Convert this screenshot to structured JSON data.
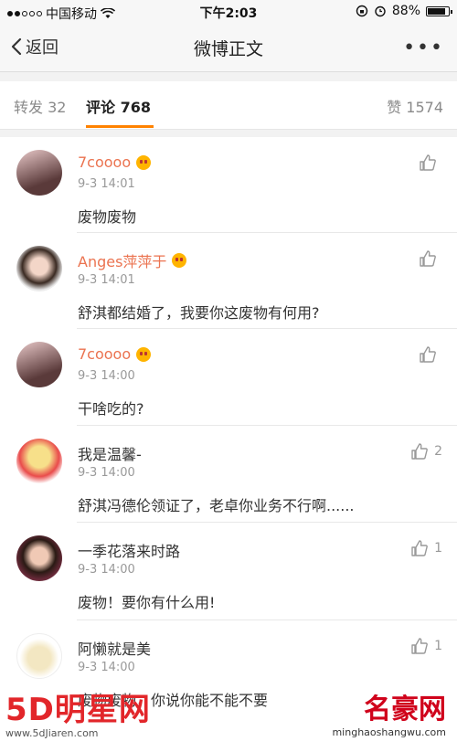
{
  "status_bar": {
    "carrier": "中国移动",
    "time": "下午2:03",
    "battery": "88%",
    "battery_level": 0.88,
    "icons": [
      "wifi-icon",
      "lock-rotation-icon",
      "alarm-icon",
      "battery-icon"
    ]
  },
  "nav": {
    "back_label": "返回",
    "title": "微博正文",
    "more_label": "•••"
  },
  "tabs": {
    "repost": "转发 32",
    "comments": "评论 768",
    "likes": "赞 1574"
  },
  "accent_color": "#ff8200",
  "vip_name_color": "#eb7350",
  "comments": [
    {
      "name": "7coooo",
      "vip": true,
      "time": "9-3 14:01",
      "text": "废物废物",
      "likes": ""
    },
    {
      "name": "Anges萍萍于",
      "vip": true,
      "time": "9-3 14:01",
      "text": "舒淇都结婚了，我要你这废物有何用?",
      "likes": ""
    },
    {
      "name": "7coooo",
      "vip": true,
      "time": "9-3 14:00",
      "text": "干啥吃的?",
      "likes": ""
    },
    {
      "name": "我是温馨-",
      "vip": false,
      "time": "9-3 14:00",
      "text": "舒淇冯德伦领证了，老卓你业务不行啊......",
      "likes": "2"
    },
    {
      "name": "一季花落来时路",
      "vip": false,
      "time": "9-3 14:00",
      "text": "废物！要你有什么用!",
      "likes": "1"
    },
    {
      "name": "阿懒就是美",
      "vip": false,
      "time": "9-3 14:00",
      "text": "废物废物，你说你能不能不要",
      "likes": "1"
    }
  ],
  "watermarks": {
    "left_brand": "5D明星网",
    "left_url": "www.5dJiaren.com",
    "right_brand": "名豪网",
    "right_url": "minghaoshangwu.com"
  }
}
